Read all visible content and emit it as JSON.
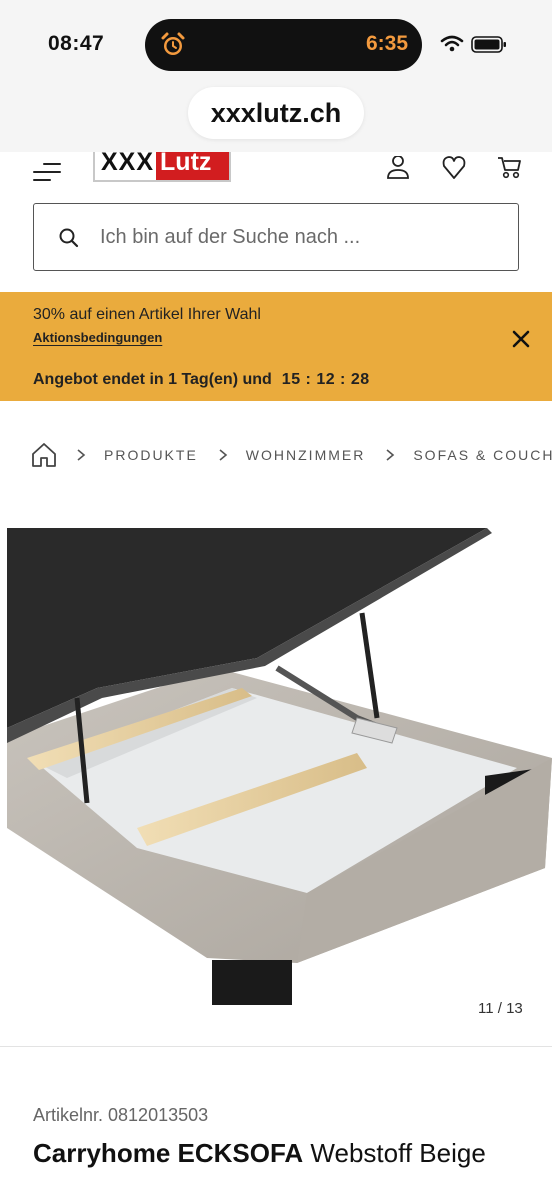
{
  "status_bar": {
    "time": "08:47",
    "activity_timer": "6:35",
    "activity_icon": "alarm-clock-icon",
    "accent_color": "#f39a3e"
  },
  "browser": {
    "url": "xxxlutz.ch"
  },
  "header": {
    "logo_left": "XXX",
    "logo_right": "Lutz",
    "brand_color": "#d21d1f",
    "icons": [
      "menu-icon",
      "account-icon",
      "wishlist-heart-icon",
      "cart-icon"
    ]
  },
  "search": {
    "placeholder": "Ich bin auf der Suche nach ..."
  },
  "promo": {
    "headline": "30% auf einen Artikel Ihrer Wahl",
    "conditions_link": "Aktionsbedingungen",
    "countdown_label": "Angebot endet in 1 Tag(en) und",
    "countdown": "15 : 12 : 28",
    "background_color": "#eaab3d"
  },
  "breadcrumb": {
    "items": [
      "PRODUKTE",
      "WOHNZIMMER",
      "SOFAS & COUCHES"
    ]
  },
  "gallery": {
    "counter": "11 / 13"
  },
  "product": {
    "article_number": "Artikelnr. 0812013503",
    "title_bold": "Carryhome ECKSOFA",
    "title_rest": "Webstoff Beige"
  }
}
